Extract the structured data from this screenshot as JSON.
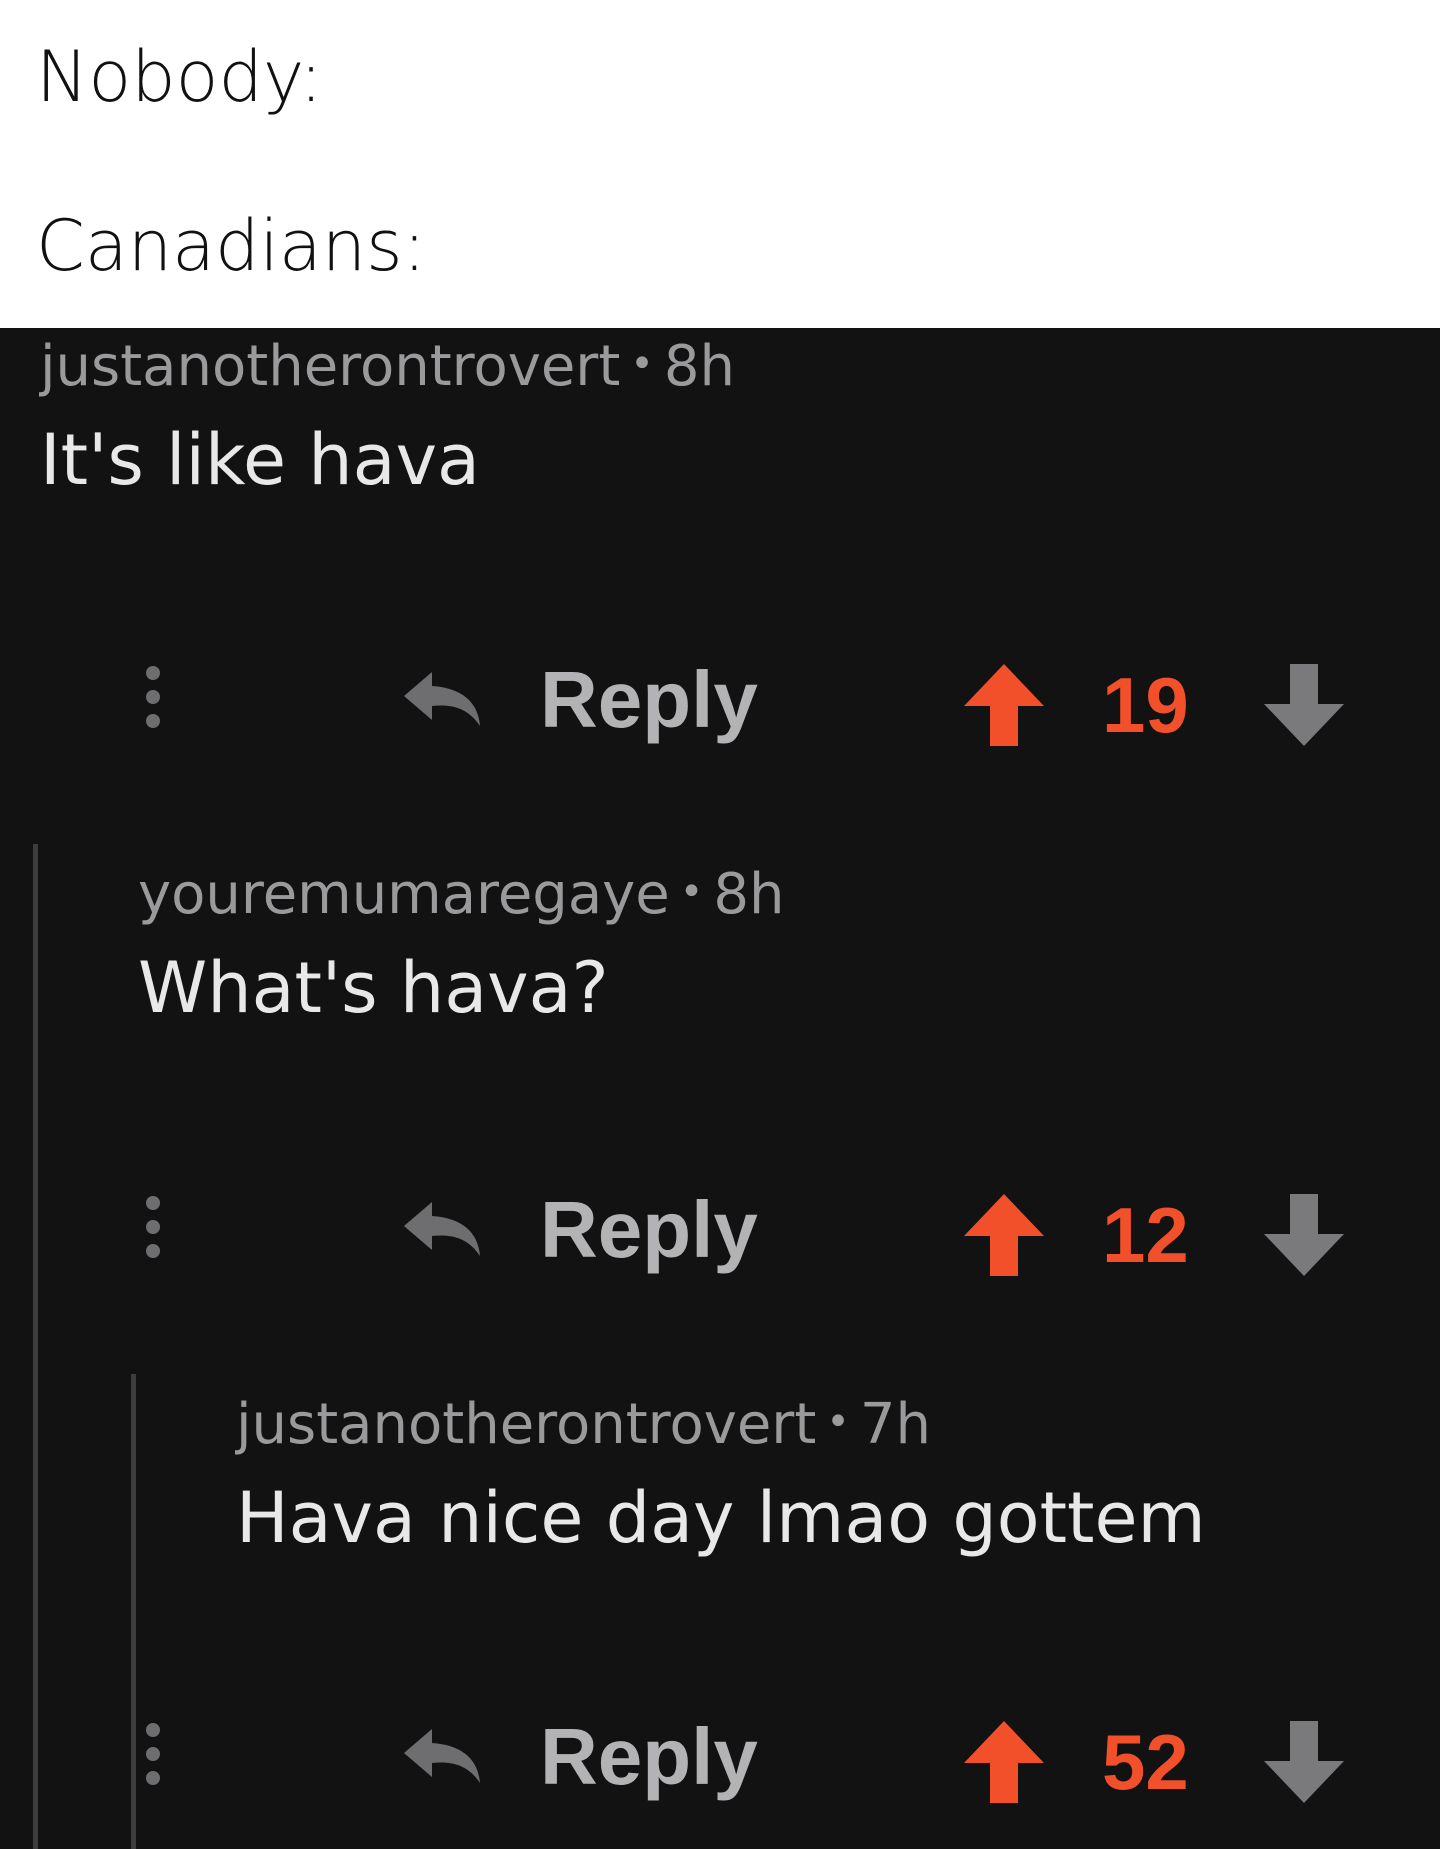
{
  "caption": {
    "line1": "Nobody:",
    "line2": "Canadians:"
  },
  "colors": {
    "background": "#121213",
    "upvote": "#f2502a",
    "downvote": "#7a7a7c",
    "meta_text": "#9a9a9c",
    "body_text": "#e8e8e8"
  },
  "comments": [
    {
      "username": "justanotherontrovert",
      "separator": "•",
      "age": "8h",
      "body": "It's like hava",
      "reply_label": "Reply",
      "score": "19",
      "icons": [
        "more-vertical-icon",
        "reply-arrow-icon",
        "upvote-arrow-icon",
        "downvote-arrow-icon"
      ]
    },
    {
      "username": "youremumaregaye",
      "separator": "•",
      "age": "8h",
      "body": "What's hava?",
      "reply_label": "Reply",
      "score": "12",
      "icons": [
        "more-vertical-icon",
        "reply-arrow-icon",
        "upvote-arrow-icon",
        "downvote-arrow-icon"
      ]
    },
    {
      "username": "justanotherontrovert",
      "separator": "•",
      "age": "7h",
      "body": "Hava nice day lmao gottem",
      "reply_label": "Reply",
      "score": "52",
      "icons": [
        "more-vertical-icon",
        "reply-arrow-icon",
        "upvote-arrow-icon",
        "downvote-arrow-icon"
      ]
    }
  ]
}
